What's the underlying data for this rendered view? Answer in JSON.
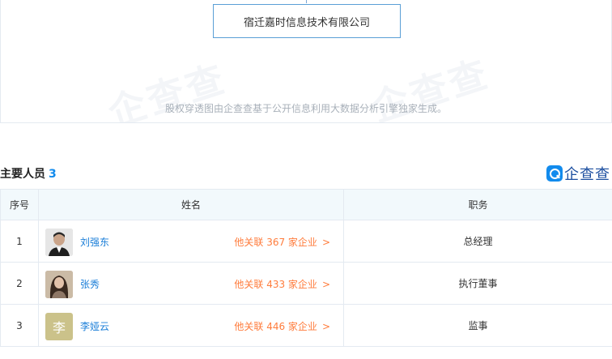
{
  "equity_chart": {
    "company_name": "宿迁嘉时信息技术有限公司",
    "watermark_text": "企查查",
    "note": "股权穿透图由企查查基于公开信息利用大数据分析引擎独家生成。"
  },
  "brand": {
    "icon": "qcc-logo-icon",
    "text": "企查查",
    "color": "#128bed"
  },
  "staff_section": {
    "title": "主要人员",
    "count": "3",
    "columns": [
      "序号",
      "姓名",
      "职务"
    ],
    "rows": [
      {
        "no": "1",
        "name": "刘强东",
        "related_prefix": "他关联",
        "related_count": "367",
        "related_suffix": "家企业",
        "arrow": ">",
        "position": "总经理",
        "avatar": "photo-avatar"
      },
      {
        "no": "2",
        "name": "张秀",
        "related_prefix": "他关联",
        "related_count": "433",
        "related_suffix": "家企业",
        "arrow": ">",
        "position": "执行董事",
        "avatar": "photo-avatar"
      },
      {
        "no": "3",
        "name": "李娅云",
        "related_prefix": "他关联",
        "related_count": "446",
        "related_suffix": "家企业",
        "arrow": ">",
        "position": "监事",
        "avatar": "李"
      }
    ]
  },
  "colors": {
    "accent": "#128bed",
    "link": "#1a7ed8",
    "related": "#ff7c3c",
    "header_bg": "#f2f9fc"
  }
}
